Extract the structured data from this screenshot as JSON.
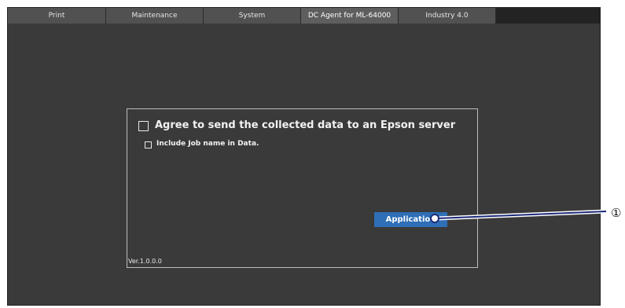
{
  "tabs": [
    {
      "label": "Print",
      "active": false
    },
    {
      "label": "Maintenance",
      "active": false
    },
    {
      "label": "System",
      "active": false
    },
    {
      "label": "DC Agent for ML-64000",
      "active": true
    },
    {
      "label": "Industry 4.0",
      "active": false
    }
  ],
  "panel": {
    "agree_label": "Agree to send the collected data to an Epson server",
    "agree_checked": false,
    "job_name_label": "Include Job name in Data.",
    "job_name_checked": false,
    "apply_label": "Application",
    "version": "Ver.1.0.0.0"
  },
  "callout": {
    "number": "①"
  },
  "colors": {
    "background": "#3a3a3a",
    "tab": "#515151",
    "button": "#2e6fb7",
    "callout_line": "#1c2a7a"
  }
}
